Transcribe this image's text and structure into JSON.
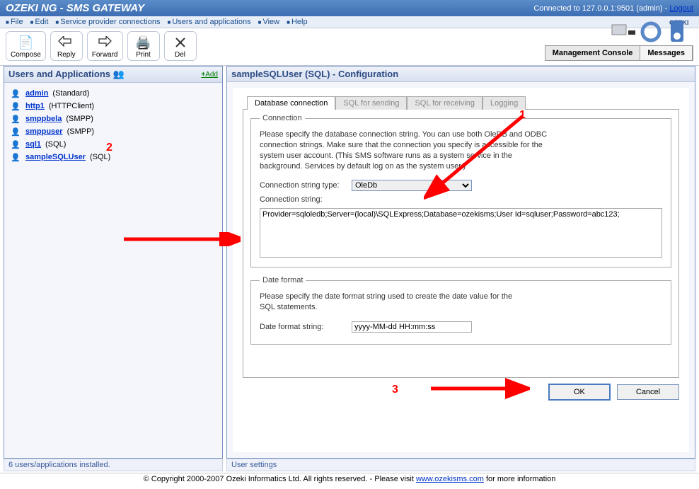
{
  "titlebar": {
    "title": "OZEKI NG - SMS GATEWAY",
    "connection": "Connected to 127.0.0.1:9501 (admin) - ",
    "logout": "Logout"
  },
  "menubar": [
    "File",
    "Edit",
    "Service provider connections",
    "Users and applications",
    "View",
    "Help"
  ],
  "toolbar": {
    "compose": "Compose",
    "reply": "Reply",
    "forward": "Forward",
    "print": "Print",
    "del": "Del"
  },
  "tabbar": {
    "console": "Management Console",
    "messages": "Messages"
  },
  "left": {
    "title": "Users and Applications",
    "add": "Add",
    "users": [
      {
        "name": "admin",
        "type": "(Standard)"
      },
      {
        "name": "http1",
        "type": "(HTTPClient)"
      },
      {
        "name": "smppbela",
        "type": "(SMPP)"
      },
      {
        "name": "smppuser",
        "type": "(SMPP)"
      },
      {
        "name": "sql1",
        "type": "(SQL)"
      },
      {
        "name": "sampleSQLUser",
        "type": "(SQL)"
      }
    ]
  },
  "right": {
    "title": "sampleSQLUser (SQL) - Configuration",
    "tabs": [
      "Database connection",
      "SQL for sending",
      "SQL for receiving",
      "Logging"
    ],
    "connection": {
      "legend": "Connection",
      "help": "Please specify the database connection string. You can use both OleDB and ODBC connection strings. Make sure that the connection you specify is accessible for the system user account. (This SMS software runs as a system service  in the background. Services by default log on as the system user.)",
      "type_label": "Connection string type:",
      "type_value": "OleDb",
      "string_label": "Connection string:",
      "string_value": "Provider=sqloledb;Server=(local)\\SQLExpress;Database=ozekisms;User Id=sqluser;Password=abc123;"
    },
    "dateformat": {
      "legend": "Date format",
      "help": "Please specify the date format string used to create the date value for the SQL statements.",
      "label": "Date format string:",
      "value": "yyyy-MM-dd HH:mm:ss"
    },
    "ok": "OK",
    "cancel": "Cancel"
  },
  "status": {
    "left": "6 users/applications installed.",
    "right": "User settings"
  },
  "copyright": {
    "text1": "© Copyright 2000-2007 Ozeki Informatics Ltd. All rights reserved. - Please visit ",
    "link": "www.ozekisms.com",
    "text2": " for more information"
  },
  "annotations": {
    "n1": "1",
    "n2": "2",
    "n3": "3"
  }
}
